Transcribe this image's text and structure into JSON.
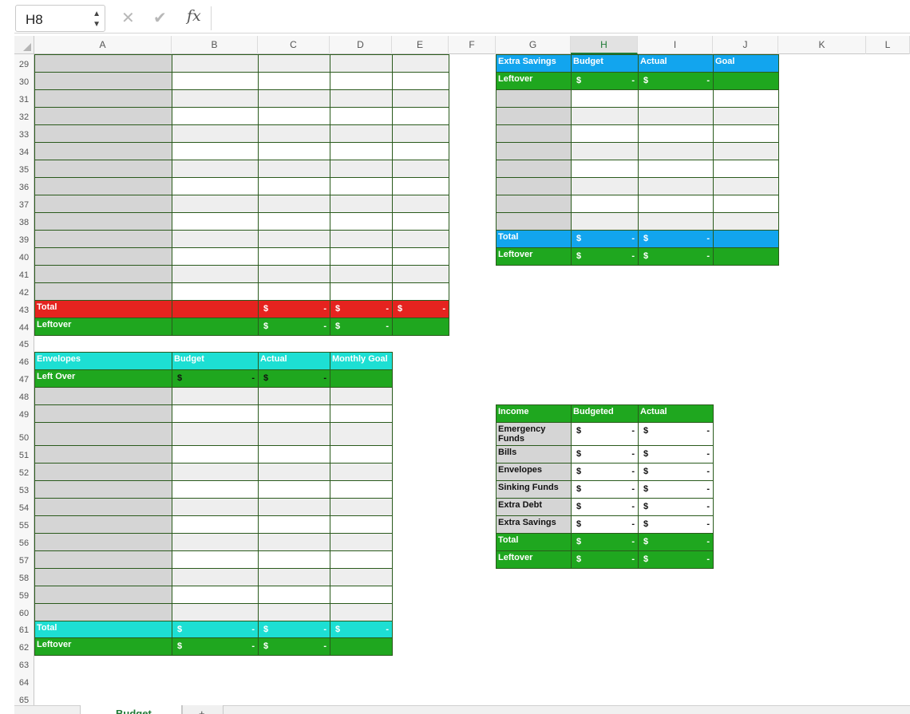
{
  "formula_bar": {
    "cell_ref": "H8",
    "formula": "",
    "cancel_icon": "x-icon",
    "confirm_icon": "check-icon",
    "fx_label": "fx"
  },
  "columns": [
    "A",
    "B",
    "C",
    "D",
    "E",
    "F",
    "G",
    "H",
    "I",
    "J",
    "K",
    "L"
  ],
  "selected_column": "H",
  "rows": [
    "29",
    "30",
    "31",
    "32",
    "33",
    "34",
    "35",
    "36",
    "37",
    "38",
    "39",
    "40",
    "41",
    "42",
    "43",
    "44",
    "45",
    "46",
    "47",
    "48",
    "49",
    "50",
    "51",
    "52",
    "53",
    "54",
    "55",
    "56",
    "57",
    "58",
    "59",
    "60",
    "61",
    "62",
    "63",
    "64",
    "65"
  ],
  "currency": {
    "symbol": "$",
    "zero": "-"
  },
  "colors": {
    "red": "#e5231f",
    "green": "#1fa71f",
    "cyan": "#1ddfd3",
    "blue": "#12a5ee",
    "gray": "#d5d5d5",
    "light": "#eeeeee",
    "border": "#2a5a1c"
  },
  "bills_table": {
    "total_label": "Total",
    "leftover_label": "Leftover"
  },
  "extra_savings": {
    "headers": [
      "Extra Savings",
      "Budget",
      "Actual",
      "Goal"
    ],
    "leftover_label": "Leftover",
    "total_label": "Total"
  },
  "envelopes": {
    "headers": [
      "Envelopes",
      "Budget",
      "Actual",
      "Monthly Goal"
    ],
    "left_over_label": "Left Over",
    "total_label": "Total",
    "leftover_label": "Leftover"
  },
  "income": {
    "headers": [
      "Income",
      "Budgeted",
      "Actual"
    ],
    "rows": [
      "Emergency Funds",
      "Bills",
      "Envelopes",
      "Sinking Funds",
      "Extra Debt",
      "Extra Savings"
    ],
    "total_label": "Total",
    "leftover_label": "Leftover"
  },
  "sheet_tabs": [
    {
      "label": "Budget"
    },
    {
      "label": "+"
    }
  ]
}
